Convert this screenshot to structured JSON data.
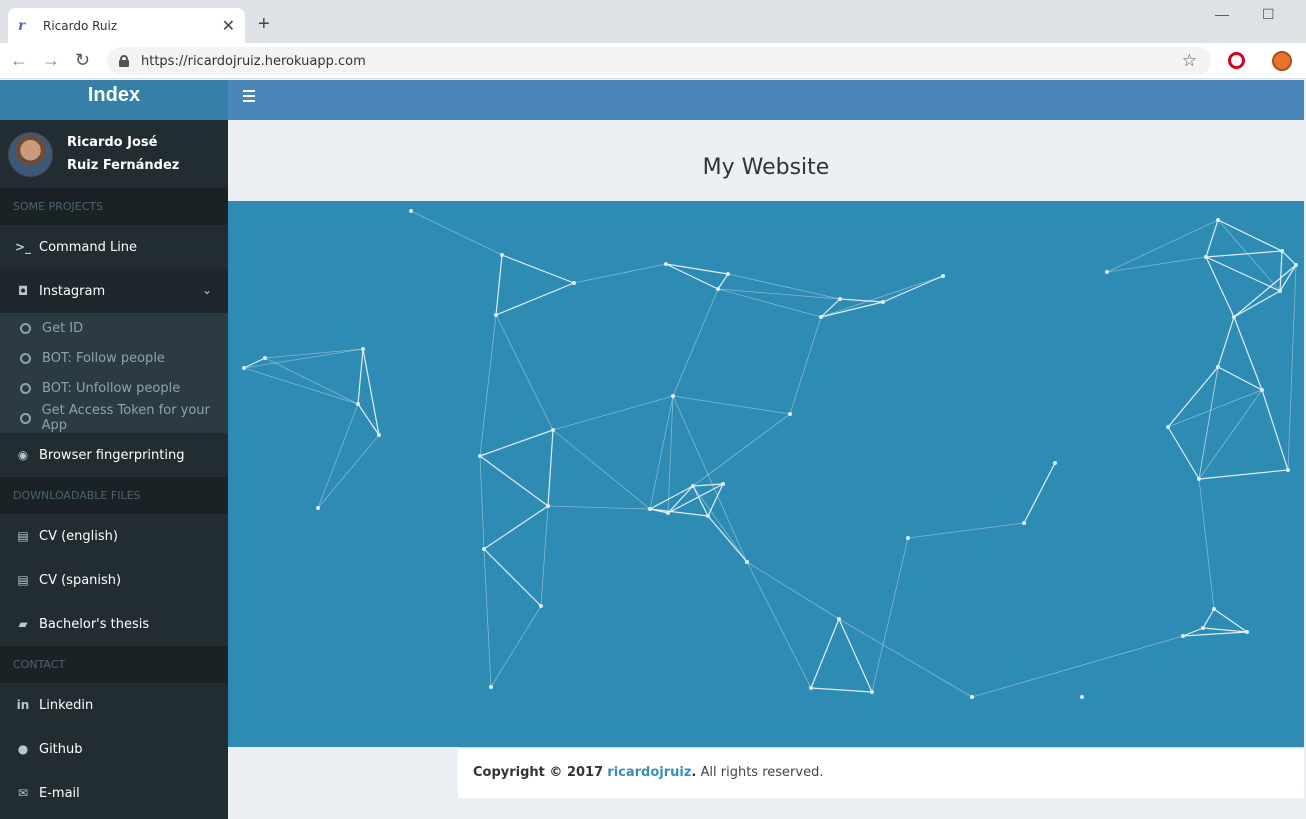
{
  "browser": {
    "tab_title": "Ricardo Ruiz",
    "url": "https://ricardojruiz.herokuapp.com"
  },
  "sidebar": {
    "logo": "Index",
    "user_first": "Ricardo José",
    "user_last": "Ruiz Fernández",
    "sections": [
      {
        "header": "SOME PROJECTS"
      },
      {
        "header": "DOWNLOADABLE FILES"
      },
      {
        "header": "CONTACT"
      }
    ],
    "items": {
      "command_line": "Command Line",
      "instagram": "Instagram",
      "instagram_sub": [
        "Get ID",
        "BOT: Follow people",
        "BOT: Unfollow people",
        "Get Access Token for your App"
      ],
      "fingerprinting": "Browser fingerprinting",
      "cv_en": "CV (english)",
      "cv_es": "CV (spanish)",
      "thesis": "Bachelor's thesis",
      "linkedin": "Linkedin",
      "github": "Github",
      "email": "E-mail"
    }
  },
  "main": {
    "title": "My Website"
  },
  "footer": {
    "copyright": "Copyright © 2017",
    "link": "ricardojruiz",
    "period": ".",
    "rest": " All rights reserved."
  },
  "colors": {
    "sidebar_bg": "#222d32",
    "header_blue": "#4a86b8",
    "network_bg": "#2e8bb3",
    "link_blue": "#3c8dbc"
  }
}
